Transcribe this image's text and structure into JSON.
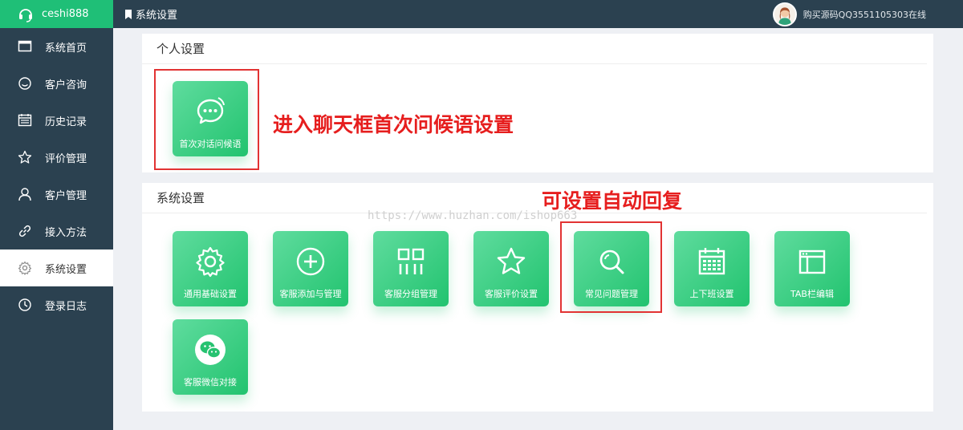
{
  "sidebar": {
    "brand": "ceshi888",
    "items": [
      {
        "label": "系统首页",
        "icon": "window-icon"
      },
      {
        "label": "客户咨询",
        "icon": "smile-icon"
      },
      {
        "label": "历史记录",
        "icon": "calendar-list-icon"
      },
      {
        "label": "评价管理",
        "icon": "star-icon"
      },
      {
        "label": "客户管理",
        "icon": "user-icon"
      },
      {
        "label": "接入方法",
        "icon": "link-icon"
      },
      {
        "label": "系统设置",
        "icon": "gear-icon",
        "active": true
      },
      {
        "label": "登录日志",
        "icon": "clock-icon"
      }
    ]
  },
  "header": {
    "breadcrumb": "系统设置",
    "user_text": "购买源码QQ3551105303在线"
  },
  "personal": {
    "title": "个人设置",
    "tiles": [
      {
        "label": "首次对话问候语",
        "icon": "chat-bubble-icon"
      }
    ]
  },
  "system": {
    "title": "系统设置",
    "tiles": [
      {
        "label": "通用基础设置",
        "icon": "gear-icon"
      },
      {
        "label": "客服添加与管理",
        "icon": "plus-circle-icon"
      },
      {
        "label": "客服分组管理",
        "icon": "group-icon"
      },
      {
        "label": "客服评价设置",
        "icon": "star-icon"
      },
      {
        "label": "常见问题管理",
        "icon": "search-icon"
      },
      {
        "label": "上下班设置",
        "icon": "calendar-icon"
      },
      {
        "label": "TAB栏编辑",
        "icon": "window-icon"
      },
      {
        "label": "客服微信对接",
        "icon": "wechat-icon"
      }
    ]
  },
  "annotations": {
    "greeting": "进入聊天框首次问候语设置",
    "auto_reply": "可设置自动回复"
  },
  "watermark": "https://www.huzhan.com/ishop663",
  "colors": {
    "sidebar_bg": "#2b4150",
    "brand_green": "#1fbf77",
    "tile_green": "#22c36f",
    "annotation_red": "#e61e1e"
  }
}
